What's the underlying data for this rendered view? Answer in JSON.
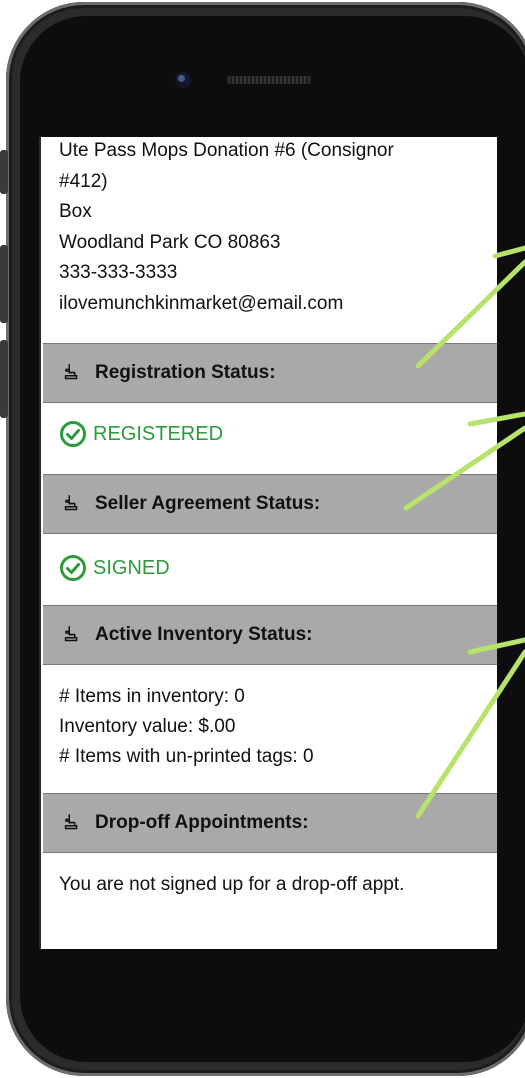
{
  "contact": {
    "line1": "Ute Pass Mops Donation #6 (Consignor",
    "line2": "#412)",
    "line3": "Box",
    "line4": "Woodland Park CO 80863",
    "line5": "333-333-3333",
    "line6": "ilovemunchkinmarket@email.com"
  },
  "sections": {
    "registration": {
      "title": "Registration Status:",
      "status": "REGISTERED"
    },
    "seller_agreement": {
      "title": "Seller Agreement Status:",
      "status": "SIGNED"
    },
    "inventory": {
      "title": "Active Inventory Status:",
      "line1": "# Items in inventory:  0",
      "line2": "Inventory value:  $.00",
      "line3": "# Items with un-printed tags:  0"
    },
    "dropoff": {
      "title": "Drop-off Appointments:",
      "text": "You are not signed up for a drop-off appt."
    }
  },
  "colors": {
    "status_green": "#2b9b3b",
    "header_gray": "#a9a9a9",
    "annotation_arrow": "#b7e36b"
  },
  "icons": [
    "hand-pointer-icon",
    "check-circle-icon"
  ]
}
